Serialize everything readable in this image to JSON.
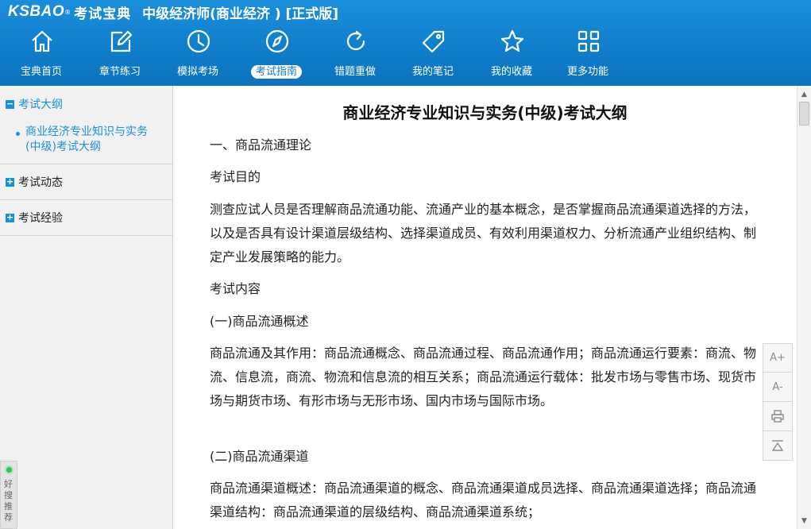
{
  "header": {
    "logo_brand": "KSBAO",
    "logo_reg": "®",
    "logo_cn": "考试宝典",
    "app_title": "中级经济师(商业经济 ) [正式版]",
    "accent_color": "#1b8fdb"
  },
  "toolbar": {
    "items": [
      {
        "label": "宝典首页",
        "icon": "home-icon"
      },
      {
        "label": "章节练习",
        "icon": "edit-icon"
      },
      {
        "label": "模拟考场",
        "icon": "clock-icon"
      },
      {
        "label": "考试指南",
        "icon": "compass-icon",
        "active": true
      },
      {
        "label": "错题重做",
        "icon": "refresh-icon"
      },
      {
        "label": "我的笔记",
        "icon": "tag-icon"
      },
      {
        "label": "我的收藏",
        "icon": "star-icon"
      },
      {
        "label": "更多功能",
        "icon": "grid-icon"
      }
    ]
  },
  "sidebar": {
    "sections": [
      {
        "box": "−",
        "title": "考试大纲",
        "open": true,
        "items": [
          "商业经济专业知识与实务(中级)考试大纲"
        ]
      },
      {
        "box": "+",
        "title": "考试动态"
      },
      {
        "box": "+",
        "title": "考试经验"
      }
    ],
    "recommend": "好搜推荐"
  },
  "document": {
    "title": "商业经济专业知识与实务(中级)考试大纲",
    "paragraphs": [
      "一、商品流通理论",
      "考试目的",
      "测查应试人员是否理解商品流通功能、流通产业的基本概念，是否掌握商品流通渠道选择的方法，以及是否具有设计渠道层级结构、选择渠道成员、有效利用渠道权力、分析流通产业组织结构、制定产业发展策略的能力。",
      "考试内容",
      "(一)商品流通概述",
      "商品流通及其作用：商品流通概念、商品流通过程、商品流通作用；商品流通运行要素：商流、物流、信息流，商流、物流和信息流的相互关系；商品流通运行载体：批发市场与零售市场、现货市场与期货市场、有形市场与无形市场、国内市场与国际市场。",
      "(二)商品流通渠道",
      "商品流通渠道概述：商品流通渠道的概念、商品流通渠道成员选择、商品流通渠道选择；商品流通渠道结构：商品流通渠道的层级结构、商品流通渠道系统；"
    ]
  },
  "sidetools": {
    "font_up": "A+",
    "font_down": "A-"
  }
}
